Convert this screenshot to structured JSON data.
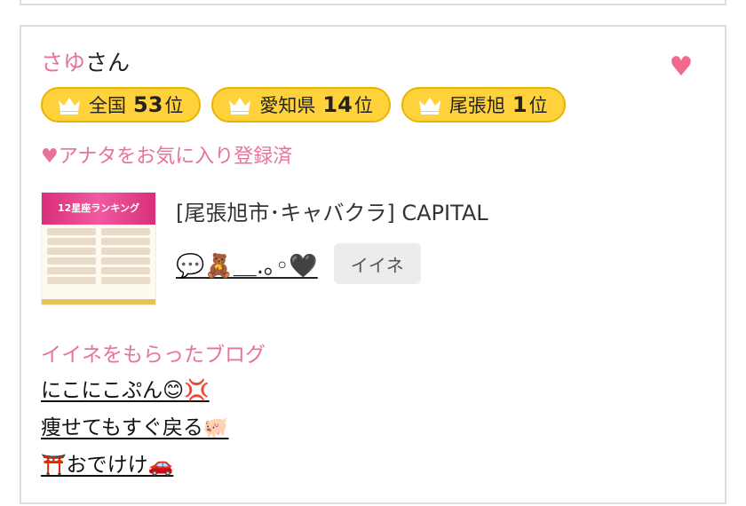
{
  "profile": {
    "name": "さゆ",
    "suffix": "さん",
    "favorite_icon": "heart-icon",
    "favorite_color": "#f06a8f"
  },
  "badges": [
    {
      "label": "全国",
      "rank": "53",
      "unit": "位",
      "icon": "crown-icon"
    },
    {
      "label": "愛知県",
      "rank": "14",
      "unit": "位",
      "icon": "crown-icon"
    },
    {
      "label": "尾張旭",
      "rank": "1",
      "unit": "位",
      "icon": "crown-icon"
    }
  ],
  "favorite_note": "♥アナタをお気に入り登録済",
  "shop": {
    "title": "[尾張旭市･キャバクラ]  CAPITAL",
    "thumbnail_heading": "12星座ランキング"
  },
  "status": {
    "text": "💬🧸＿.｡◦🖤",
    "like_button": "イイネ"
  },
  "blog": {
    "heading": "イイネをもらったブログ",
    "items": [
      "にこにこぷん😊💢",
      "痩せてもすぐ戻る🐖",
      "⛩️おでけけ🚗"
    ]
  },
  "colors": {
    "accent_pink": "#e8729e",
    "badge_yellow": "#ffd23b"
  }
}
